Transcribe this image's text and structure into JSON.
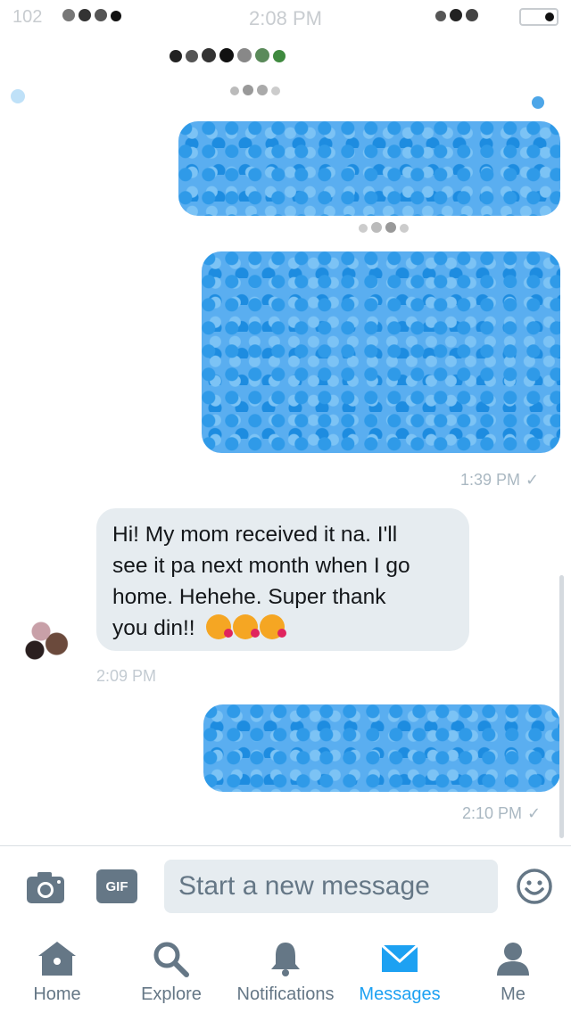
{
  "status_bar": {
    "carrier": "102",
    "time": "2:08 PM"
  },
  "header": {
    "title": ""
  },
  "messages": [
    {
      "kind": "outgoing",
      "blurred": true
    },
    {
      "kind": "outgoing",
      "blurred": true,
      "timestamp": "1:39 PM",
      "status": "✓"
    },
    {
      "kind": "incoming",
      "lines": [
        "Hi! My mom received it na. I'll",
        "see it pa next month when I go",
        "home. Hehehe. Super thank",
        "you din!!"
      ],
      "emojis": [
        "face-throwing-kiss",
        "face-throwing-kiss",
        "face-throwing-kiss"
      ],
      "timestamp": "2:09 PM"
    },
    {
      "kind": "outgoing",
      "blurred": true,
      "timestamp": "2:10 PM",
      "status": "✓"
    }
  ],
  "composer": {
    "placeholder": "Start a new message",
    "gif_label": "GIF"
  },
  "tabs": [
    {
      "label": "Home",
      "icon": "home-icon",
      "active": false
    },
    {
      "label": "Explore",
      "icon": "search-icon",
      "active": false
    },
    {
      "label": "Notifications",
      "icon": "bell-icon",
      "active": false
    },
    {
      "label": "Messages",
      "icon": "envelope-icon",
      "active": true
    },
    {
      "label": "Me",
      "icon": "person-icon",
      "active": false
    }
  ],
  "colors": {
    "accent": "#1da1f2",
    "bubble_in": "#e6ecf0",
    "icon_gray": "#657786"
  }
}
